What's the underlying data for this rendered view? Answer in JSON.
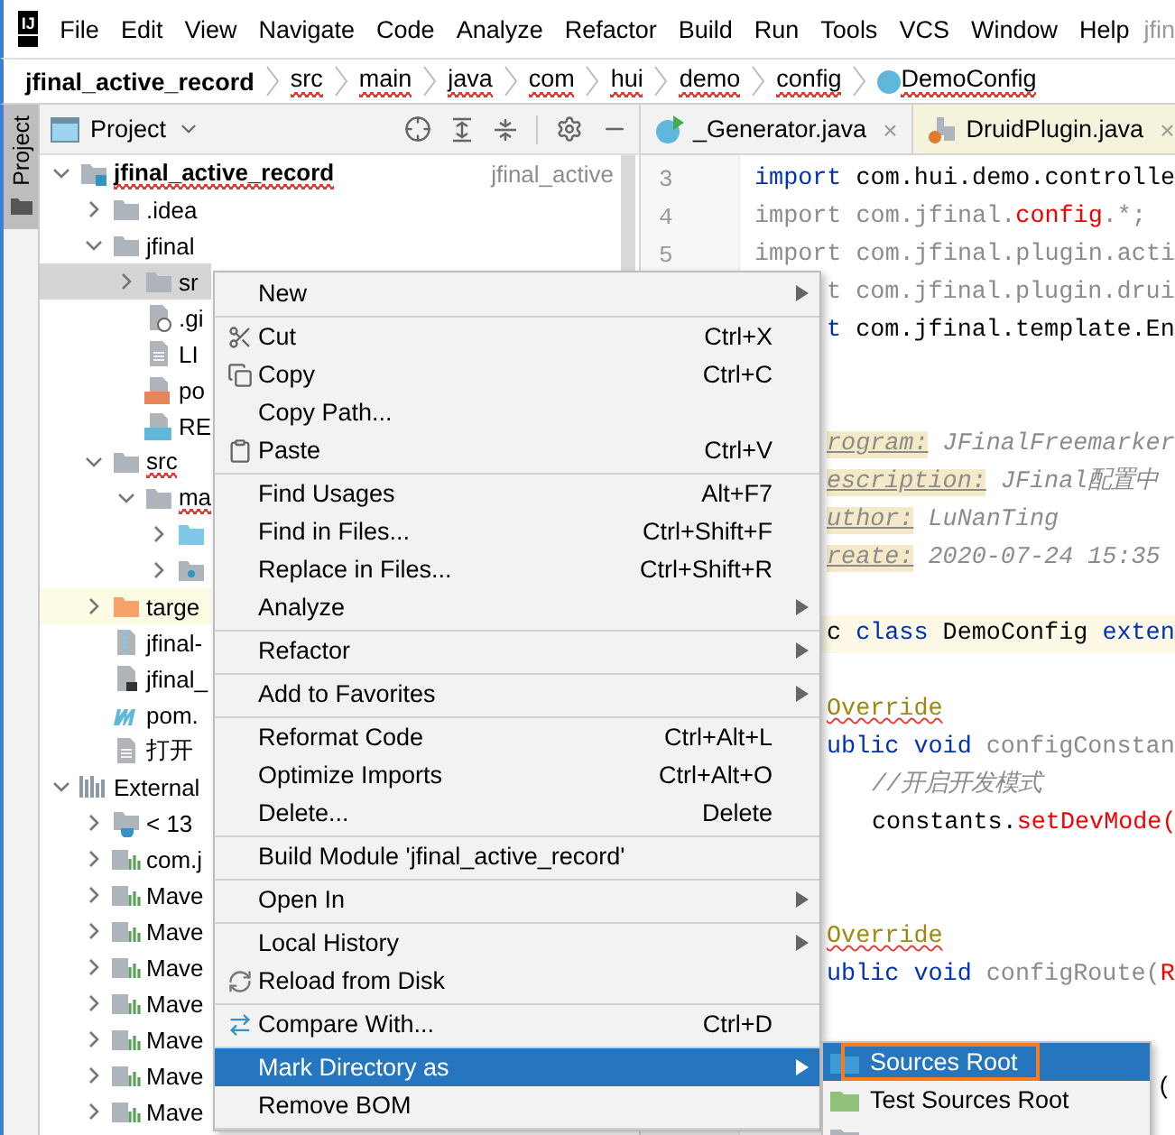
{
  "menu_bar": {
    "logo_text": "IJ",
    "items": [
      "File",
      "Edit",
      "View",
      "Navigate",
      "Code",
      "Analyze",
      "Refactor",
      "Build",
      "Run",
      "Tools",
      "VCS",
      "Window",
      "Help"
    ],
    "title": "jfin"
  },
  "breadcrumb": [
    {
      "label": "jfinal_active_record",
      "kind": "project",
      "misspelled": false
    },
    {
      "label": "src",
      "kind": "dir",
      "misspelled": true
    },
    {
      "label": "main",
      "kind": "dir",
      "misspelled": true
    },
    {
      "label": "java",
      "kind": "dir",
      "misspelled": true
    },
    {
      "label": "com",
      "kind": "dir",
      "misspelled": true
    },
    {
      "label": "hui",
      "kind": "dir",
      "misspelled": true
    },
    {
      "label": "demo",
      "kind": "dir",
      "misspelled": true
    },
    {
      "label": "config",
      "kind": "dir",
      "misspelled": true
    },
    {
      "label": "DemoConfig",
      "kind": "class",
      "misspelled": true
    }
  ],
  "tool_stripe": {
    "tabs": [
      {
        "label": "Project",
        "selected": true
      }
    ]
  },
  "project_panel": {
    "title": "Project",
    "tree": [
      {
        "label": "jfinal_active_record",
        "kind": "module",
        "expanded": true,
        "selected": false,
        "misspelled": true,
        "hint": "jfinal_active",
        "children": [
          {
            "label": ".idea",
            "kind": "folder",
            "expanded": false,
            "selected": false,
            "misspelled": false
          },
          {
            "label": "jfinal",
            "kind": "folder",
            "expanded": true,
            "selected": false,
            "misspelled": false,
            "children": [
              {
                "label": "sr",
                "kind": "folder",
                "expanded": false,
                "selected": true,
                "misspelled": false
              },
              {
                "label": ".gi",
                "kind": "ignored",
                "selected": false,
                "misspelled": false
              },
              {
                "label": "LI",
                "kind": "file",
                "selected": false,
                "misspelled": false
              },
              {
                "label": "po",
                "kind": "xml",
                "selected": false,
                "misspelled": false
              },
              {
                "label": "RE",
                "kind": "md",
                "selected": false,
                "misspelled": false
              }
            ]
          },
          {
            "label": "src",
            "kind": "folder",
            "expanded": true,
            "selected": false,
            "misspelled": true,
            "children": [
              {
                "label": "ma",
                "kind": "folder",
                "expanded": true,
                "selected": false,
                "misspelled": true,
                "children": [
                  {
                    "kind": "source",
                    "expanded": false,
                    "selected": false
                  },
                  {
                    "kind": "resources",
                    "expanded": false,
                    "selected": false
                  }
                ]
              }
            ]
          },
          {
            "label": "targe",
            "kind": "excluded",
            "expanded": false,
            "selected": false,
            "misspelled": false
          },
          {
            "label": "jfinal-",
            "kind": "archive",
            "selected": false,
            "misspelled": false
          },
          {
            "label": "jfinal_",
            "kind": "launcher",
            "selected": false,
            "misspelled": false
          },
          {
            "label": "pom.",
            "kind": "maven",
            "selected": false,
            "misspelled": false
          },
          {
            "label": "打开",
            "kind": "file",
            "selected": false,
            "misspelled": false
          }
        ]
      },
      {
        "label": "External",
        "kind": "libraries",
        "expanded": true,
        "selected": false,
        "misspelled": false,
        "children": [
          {
            "label": "< 13",
            "kind": "jdk",
            "expanded": false,
            "selected": false,
            "misspelled": false
          },
          {
            "label": "com.j",
            "kind": "library",
            "expanded": false,
            "selected": false,
            "misspelled": false
          },
          {
            "label": "Mave",
            "kind": "library",
            "expanded": false,
            "selected": false,
            "misspelled": false
          },
          {
            "label": "Mave",
            "kind": "library",
            "expanded": false,
            "selected": false,
            "misspelled": false
          },
          {
            "label": "Mave",
            "kind": "library",
            "expanded": false,
            "selected": false,
            "misspelled": false
          },
          {
            "label": "Mave",
            "kind": "library",
            "expanded": false,
            "selected": false,
            "misspelled": false
          },
          {
            "label": "Mave",
            "kind": "library",
            "expanded": false,
            "selected": false,
            "misspelled": false
          },
          {
            "label": "Mave",
            "kind": "library",
            "expanded": false,
            "selected": false,
            "misspelled": false
          },
          {
            "label": "Mave",
            "kind": "library",
            "expanded": false,
            "selected": false,
            "misspelled": false
          }
        ]
      }
    ]
  },
  "editor_tabs": [
    {
      "label": "_Generator.java",
      "kind": "runnable",
      "selected": false,
      "close": "×"
    },
    {
      "label": "DruidPlugin.java",
      "kind": "library",
      "selected": false,
      "close": "×"
    }
  ],
  "editor": {
    "lines": [
      {
        "number": "3",
        "kind": "full",
        "segments": [
          {
            "kind": "keyword",
            "text": "import"
          },
          {
            "kind": "plain",
            "text": " com.hui.demo.controlle"
          }
        ]
      },
      {
        "number": "4",
        "kind": "full",
        "segments": [
          {
            "kind": "unused",
            "text": "import com.jfinal."
          },
          {
            "kind": "error",
            "text": "config"
          },
          {
            "kind": "unused",
            "text": ".*;"
          }
        ]
      },
      {
        "number": "5",
        "kind": "full",
        "segments": [
          {
            "kind": "unused",
            "text": "import com.jfinal.plugin.acti"
          }
        ]
      },
      {
        "kind": "cut",
        "segments": [
          {
            "kind": "unused",
            "text": "t com.jfinal.plugin.drui"
          }
        ]
      },
      {
        "kind": "cut",
        "segments": [
          {
            "kind": "keyword",
            "text": "t"
          },
          {
            "kind": "plain",
            "text": " com.jfinal.template.En"
          }
        ]
      },
      {
        "kind": "blank"
      },
      {
        "kind": "blank"
      },
      {
        "kind": "cut",
        "segments": [
          {
            "kind": "doctag",
            "text": "rogram:"
          },
          {
            "kind": "doc",
            "text": " JFinalFreemarker"
          }
        ]
      },
      {
        "kind": "cut",
        "segments": [
          {
            "kind": "doctag",
            "text": "escription:"
          },
          {
            "kind": "doc",
            "text": " JFinal配置中"
          }
        ]
      },
      {
        "kind": "cut",
        "segments": [
          {
            "kind": "doctag",
            "text": "uthor:"
          },
          {
            "kind": "doc",
            "text": " LuNanTing"
          }
        ]
      },
      {
        "kind": "cut",
        "segments": [
          {
            "kind": "doctag",
            "text": "reate:"
          },
          {
            "kind": "doc",
            "text": " 2020-07-24 15:35"
          }
        ]
      },
      {
        "kind": "blank"
      },
      {
        "kind": "current",
        "segments": [
          {
            "kind": "plain",
            "text": "c "
          },
          {
            "kind": "keyword",
            "text": "class"
          },
          {
            "kind": "plain",
            "text": " DemoConfig "
          },
          {
            "kind": "keyword",
            "text": "exten"
          }
        ]
      },
      {
        "kind": "blank"
      },
      {
        "kind": "cut",
        "segments": [
          {
            "kind": "annotation",
            "text": "Override"
          }
        ]
      },
      {
        "kind": "cut",
        "segments": [
          {
            "kind": "keyword",
            "text": "ublic void"
          },
          {
            "kind": "unused",
            "text": " configConstan"
          }
        ]
      },
      {
        "kind": "indented",
        "segments": [
          {
            "kind": "comment",
            "text": "//开启开发模式"
          }
        ]
      },
      {
        "kind": "indented",
        "segments": [
          {
            "kind": "plain",
            "text": "constants."
          },
          {
            "kind": "error",
            "text": "setDevMode("
          }
        ]
      },
      {
        "kind": "blank"
      },
      {
        "kind": "blank"
      },
      {
        "kind": "cut",
        "segments": [
          {
            "kind": "annotation",
            "text": "Override"
          }
        ]
      },
      {
        "kind": "cut",
        "segments": [
          {
            "kind": "keyword",
            "text": "ublic void"
          },
          {
            "kind": "unused",
            "text": " configRoute("
          },
          {
            "kind": "error",
            "text": "R"
          }
        ]
      },
      {
        "kind": "blank"
      },
      {
        "kind": "blank"
      },
      {
        "kind": "tail",
        "segments": [
          {
            "kind": "plain",
            "text": "("
          }
        ]
      }
    ]
  },
  "context_menu": [
    {
      "label": "New",
      "kind": "plain",
      "submenu": true,
      "separator_after": true,
      "selected": false
    },
    {
      "label": "Cut",
      "kind": "cut",
      "shortcut": "Ctrl+X",
      "selected": false
    },
    {
      "label": "Copy",
      "kind": "copy",
      "shortcut": "Ctrl+C",
      "selected": false
    },
    {
      "label": "Copy Path...",
      "kind": "plain",
      "selected": false
    },
    {
      "label": "Paste",
      "kind": "paste",
      "shortcut": "Ctrl+V",
      "separator_after": true,
      "selected": false
    },
    {
      "label": "Find Usages",
      "kind": "plain",
      "shortcut": "Alt+F7",
      "selected": false
    },
    {
      "label": "Find in Files...",
      "kind": "plain",
      "shortcut": "Ctrl+Shift+F",
      "selected": false
    },
    {
      "label": "Replace in Files...",
      "kind": "plain",
      "shortcut": "Ctrl+Shift+R",
      "selected": false
    },
    {
      "label": "Analyze",
      "kind": "plain",
      "submenu": true,
      "separator_after": true,
      "selected": false
    },
    {
      "label": "Refactor",
      "kind": "plain",
      "submenu": true,
      "separator_after": true,
      "selected": false
    },
    {
      "label": "Add to Favorites",
      "kind": "plain",
      "submenu": true,
      "separator_after": true,
      "selected": false
    },
    {
      "label": "Reformat Code",
      "kind": "plain",
      "shortcut": "Ctrl+Alt+L",
      "selected": false
    },
    {
      "label": "Optimize Imports",
      "kind": "plain",
      "shortcut": "Ctrl+Alt+O",
      "selected": false
    },
    {
      "label": "Delete...",
      "kind": "plain",
      "shortcut": "Delete",
      "separator_after": true,
      "selected": false
    },
    {
      "label": "Build Module 'jfinal_active_record'",
      "kind": "plain",
      "separator_after": true,
      "selected": false
    },
    {
      "label": "Open In",
      "kind": "plain",
      "submenu": true,
      "separator_after": true,
      "selected": false
    },
    {
      "label": "Local History",
      "kind": "plain",
      "submenu": true,
      "selected": false
    },
    {
      "label": "Reload from Disk",
      "kind": "reload",
      "separator_after": true,
      "selected": false
    },
    {
      "label": "Compare With...",
      "kind": "compare",
      "shortcut": "Ctrl+D",
      "separator_after": true,
      "selected": false
    },
    {
      "label": "Mark Directory as",
      "kind": "plain",
      "submenu": true,
      "selected": true
    },
    {
      "label": "Remove BOM",
      "kind": "plain",
      "separator_after": true,
      "selected": false
    }
  ],
  "submenu": [
    {
      "label": "Sources Root",
      "kind": "source",
      "selected": true,
      "focused": true
    },
    {
      "label": "Test Sources Root",
      "kind": "test",
      "selected": false,
      "focused": false
    },
    {
      "kind": "resources",
      "selected": false
    }
  ]
}
